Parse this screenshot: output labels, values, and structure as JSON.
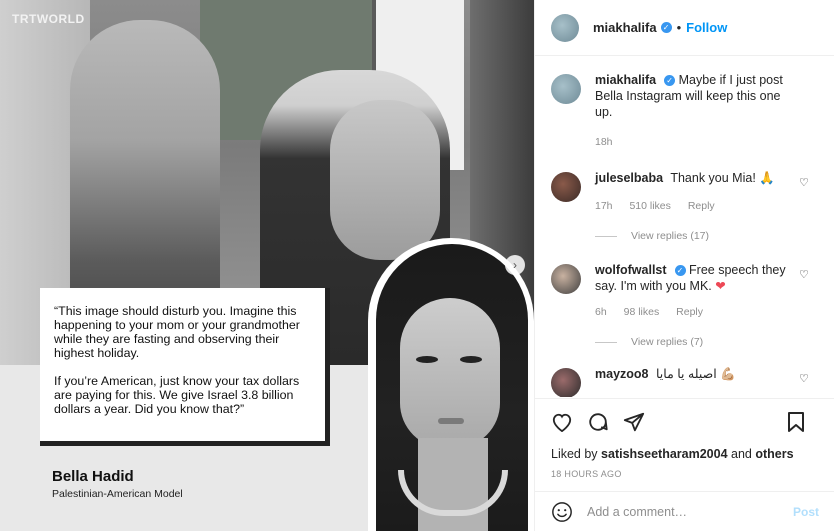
{
  "image": {
    "watermark": "TRTWORLD",
    "quote": {
      "paragraph1": "“This image should disturb you. Imagine this happening to your mom or your grandmother while they are fasting and observing their highest holiday.",
      "paragraph2": "If you’re American, just know your tax dollars are paying for this. We give Israel 3.8 billion dollars a year. Did you know that?”"
    },
    "attribution": {
      "name": "Bella Hadid",
      "role": "Palestinian-American Model"
    },
    "carousel_next_icon": "chevron-right-icon"
  },
  "header": {
    "username": "miakhalifa",
    "separator": "•",
    "follow_label": "Follow"
  },
  "comments": [
    {
      "username": "miakhalifa",
      "text": "Maybe if I just post Bella Instagram will keep this one up.",
      "time": "18h"
    },
    {
      "username": "juleselbaba",
      "text": "Thank you Mia! 🙏",
      "time": "17h",
      "likes": "510 likes",
      "reply": "Reply",
      "view_replies": "View replies (17)"
    },
    {
      "username": "wolfofwallst",
      "text": "Free speech they say. I'm with you MK.",
      "heart": "❤",
      "time": "6h",
      "likes": "98 likes",
      "reply": "Reply",
      "view_replies": "View replies (7)"
    },
    {
      "username": "mayzoo8",
      "text": "اصيله يا مايا 💪🏼"
    }
  ],
  "actions": {
    "liked_by_prefix": "Liked by",
    "liked_by_user": "satishseetharam2004",
    "liked_by_and": "and",
    "liked_by_others": "others",
    "time_ago": "18 HOURS AGO"
  },
  "add_comment": {
    "placeholder": "Add a comment…",
    "post_label": "Post"
  },
  "colors": {
    "accent": "#0095f6",
    "verified": "#3897f0",
    "heart": "#ed4956",
    "muted": "#8e8e8e"
  }
}
